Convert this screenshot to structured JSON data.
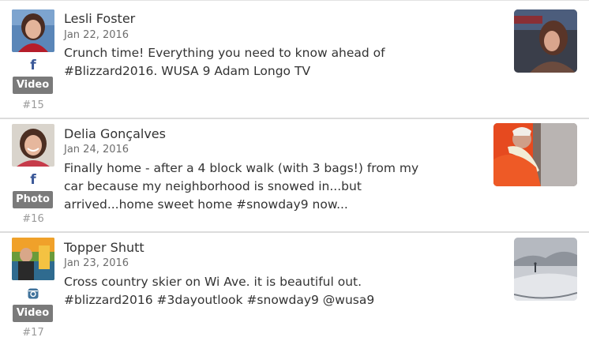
{
  "posts": [
    {
      "author": "Lesli Foster",
      "date": "Jan 22, 2016",
      "text": "Crunch time! Everything you need to know ahead of #Blizzard2016. WUSA 9 Adam Longo TV",
      "source_icon": "facebook-icon",
      "source_glyph": "f",
      "media_type": "Video",
      "rank": "#15"
    },
    {
      "author": "Delia Gonçalves",
      "date": "Jan 24, 2016",
      "text": "Finally home - after a 4 block walk (with 3 bags!) from my car because my neighborhood is snowed in...but arrived...home sweet home #snowday9 now...",
      "source_icon": "facebook-icon",
      "source_glyph": "f",
      "media_type": "Photo",
      "rank": "#16"
    },
    {
      "author": "Topper Shutt",
      "date": "Jan 23, 2016",
      "text": "Cross country skier on Wi Ave. it is beautiful out. #blizzard2016 #3dayoutlook #snowday9 @wusa9",
      "source_icon": "instagram-icon",
      "media_type": "Video",
      "rank": "#17"
    }
  ],
  "colors": {
    "facebook": "#3b5998",
    "instagram": "#3f729b",
    "badge": "#7a7a7a",
    "separator": "#dcdcdc"
  }
}
